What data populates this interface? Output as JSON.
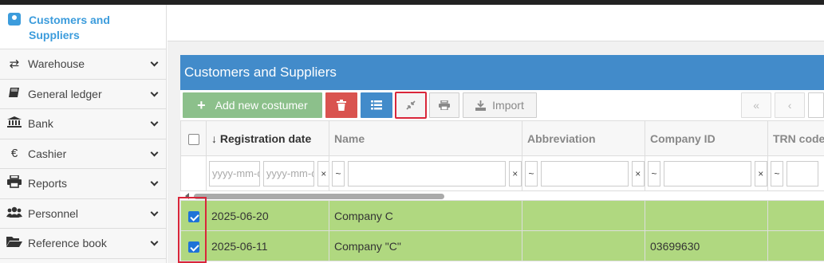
{
  "sidebar": {
    "active": {
      "label": "Customers and Suppliers",
      "icon": "address-book-icon"
    },
    "items": [
      {
        "label": "Warehouse",
        "icon": "exchange-icon"
      },
      {
        "label": "General ledger",
        "icon": "book-icon"
      },
      {
        "label": "Bank",
        "icon": "bank-icon"
      },
      {
        "label": "Cashier",
        "icon": "euro-icon"
      },
      {
        "label": "Reports",
        "icon": "print-icon"
      },
      {
        "label": "Personnel",
        "icon": "users-icon"
      },
      {
        "label": "Reference book",
        "icon": "folder-open-icon"
      }
    ]
  },
  "panel": {
    "title": "Customers and Suppliers"
  },
  "toolbar": {
    "add_label": "Add new costumer",
    "import_label": "Import"
  },
  "table": {
    "columns": [
      "Registration date",
      "Name",
      "Abbreviation",
      "Company ID",
      "TRN code"
    ],
    "sort_indicator": "↓",
    "filters": {
      "date_from_placeholder": "yyyy-mm-dd",
      "date_to_placeholder": "yyyy-mm-dd",
      "op": "~",
      "clear": "×"
    },
    "rows": [
      {
        "checked": true,
        "date": "2025-06-20",
        "name": "Company C",
        "abbreviation": "",
        "company_id": "",
        "trn": ""
      },
      {
        "checked": true,
        "date": "2025-06-11",
        "name": "Company \"C\"",
        "abbreviation": "",
        "company_id": "03699630",
        "trn": ""
      }
    ]
  },
  "colors": {
    "accent": "#428bca",
    "active_link": "#3c9cdc",
    "add_button": "#8cc08b",
    "delete_button": "#d9534f",
    "selected_row": "#b0d880",
    "highlight_box": "#d9263a"
  }
}
